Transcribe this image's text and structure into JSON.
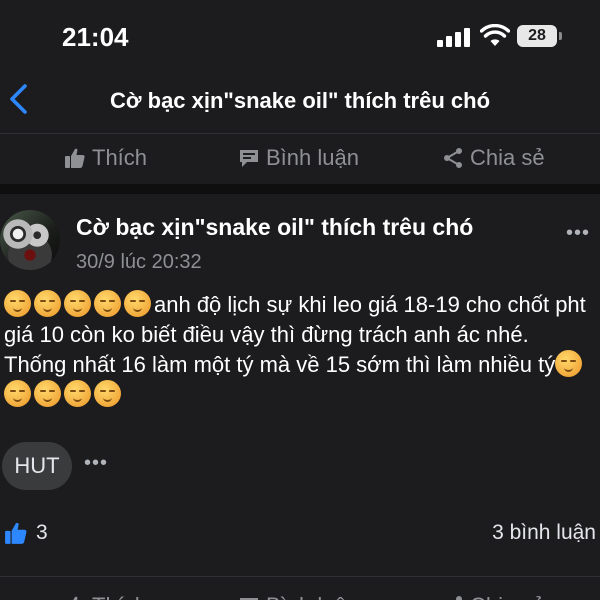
{
  "status_bar": {
    "time": "21:04",
    "battery": "28"
  },
  "nav": {
    "title": "Cờ bạc xịn\"snake oil\" thích trêu chó"
  },
  "actions": {
    "like": "Thích",
    "comment": "Bình luận",
    "share": "Chia sẻ"
  },
  "post": {
    "author": "Cờ bạc xịn\"snake oil\" thích trêu chó",
    "timestamp": "30/9 lúc 20:32",
    "text_part1": "anh độ lịch sự khi leo giá 18-19 cho chốt pht giá 10 còn ko biết điều vậy thì đừng trách anh ác nhé.  Thống nhất 16 làm một tý mà về 15 sớm thì làm nhiều tý",
    "emoji": "smirking-face",
    "tag": "HUT",
    "like_count": "3",
    "comment_count": "3 bình luận"
  },
  "colors": {
    "background": "#1c1c1e",
    "accent": "#2d88ff",
    "muted": "#8e9094"
  }
}
